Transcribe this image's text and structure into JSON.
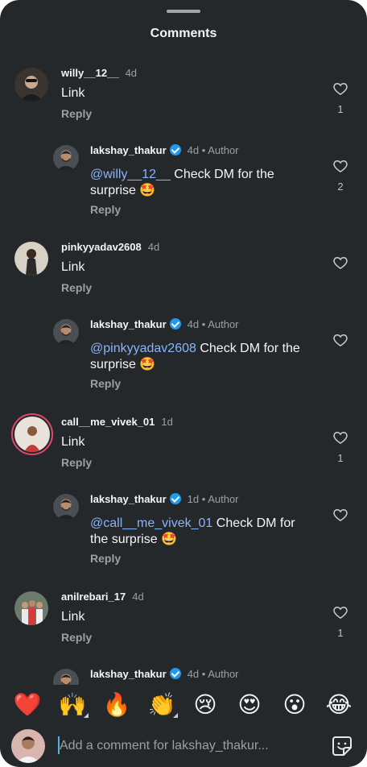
{
  "header": {
    "title": "Comments"
  },
  "comments": [
    {
      "username": "willy__12__",
      "time": "4d",
      "text": "Link",
      "reply_label": "Reply",
      "likes": "1",
      "reply": {
        "username": "lakshay_thakur",
        "time": "4d",
        "author_label": "• Author",
        "mention": "@willy__12__",
        "text_line1_rest": " Check DM for the",
        "text_line2": "surprise 🤩",
        "reply_label": "Reply",
        "likes": "2"
      }
    },
    {
      "username": "pinkyyadav2608",
      "time": "4d",
      "text": "Link",
      "reply_label": "Reply",
      "likes": "",
      "reply": {
        "username": "lakshay_thakur",
        "time": "4d",
        "author_label": "• Author",
        "mention": "@pinkyyadav2608",
        "text_line1_rest": " Check DM for the",
        "text_line2": "surprise 🤩",
        "reply_label": "Reply",
        "likes": ""
      }
    },
    {
      "username": "call__me_vivek_01",
      "time": "1d",
      "text": "Link",
      "reply_label": "Reply",
      "likes": "1",
      "reply": {
        "username": "lakshay_thakur",
        "time": "1d",
        "author_label": "• Author",
        "mention": "@call__me_vivek_01",
        "text_line1_rest": " Check DM for",
        "text_line2": "the surprise 🤩",
        "reply_label": "Reply",
        "likes": ""
      }
    },
    {
      "username": "anilrebari_17",
      "time": "4d",
      "text": "Link",
      "reply_label": "Reply",
      "likes": "1",
      "reply": {
        "username": "lakshay_thakur",
        "time": "4d",
        "author_label": "• Author"
      }
    }
  ],
  "emoji_bar": [
    {
      "glyph": "❤️",
      "icon": "red-heart-emoji"
    },
    {
      "glyph": "🙌",
      "icon": "raising-hands-emoji"
    },
    {
      "glyph": "🔥",
      "icon": "fire-emoji"
    },
    {
      "glyph": "👏",
      "icon": "clapping-hands-emoji"
    },
    {
      "glyph": "😢",
      "icon": "crying-face-emoji"
    },
    {
      "glyph": "😍",
      "icon": "heart-eyes-emoji"
    },
    {
      "glyph": "😮",
      "icon": "surprised-face-emoji"
    },
    {
      "glyph": "😂",
      "icon": "tears-of-joy-emoji"
    }
  ],
  "composer": {
    "placeholder": "Add a comment for lakshay_thakur..."
  },
  "colors": {
    "background": "#25282b",
    "text": "#f5f5f5",
    "muted": "#9aa0a6",
    "mention": "#8ab4f8",
    "verified": "#1d9bf0"
  }
}
